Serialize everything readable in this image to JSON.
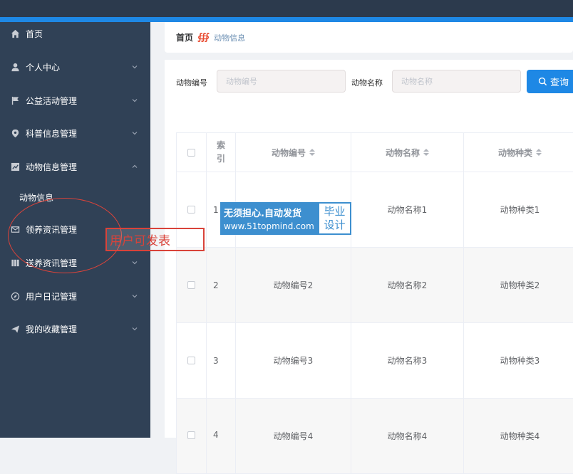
{
  "sidebar": {
    "items": [
      {
        "label": "首页",
        "icon": "home-icon"
      },
      {
        "label": "个人中心",
        "icon": "user-icon"
      },
      {
        "label": "公益活动管理",
        "icon": "flag-icon"
      },
      {
        "label": "科普信息管理",
        "icon": "location-icon"
      },
      {
        "label": "动物信息管理",
        "icon": "chart-icon"
      },
      {
        "label": "领养资讯管理",
        "icon": "mail-icon"
      },
      {
        "label": "送养资讯管理",
        "icon": "bookmark-icon"
      },
      {
        "label": "用户日记管理",
        "icon": "compass-icon"
      },
      {
        "label": "我的收藏管理",
        "icon": "send-icon"
      }
    ],
    "submenu_label": "动物信息"
  },
  "breadcrumb": {
    "home": "首页",
    "separator": "∰",
    "current": "动物信息"
  },
  "search": {
    "field1_label": "动物编号",
    "field1_placeholder": "动物编号",
    "field2_label": "动物名称",
    "field2_placeholder": "动物名称",
    "button_label": "查询"
  },
  "table": {
    "headers": [
      "索\n引",
      "动物编号",
      "动物名称",
      "动物种类"
    ],
    "rows": [
      {
        "index": "1",
        "code": "",
        "name": "动物名称1",
        "type": "动物种类1"
      },
      {
        "index": "2",
        "code": "动物编号2",
        "name": "动物名称2",
        "type": "动物种类2"
      },
      {
        "index": "3",
        "code": "动物编号3",
        "name": "动物名称3",
        "type": "动物种类3"
      },
      {
        "index": "4",
        "code": "动物编号4",
        "name": "动物名称4",
        "type": "动物种类4"
      }
    ]
  },
  "annotation": {
    "note": "用户可发表"
  },
  "watermark": {
    "line1": "无须担心.自动发货",
    "line2": "www.51topmind.com",
    "right_line1": "毕业",
    "right_line2": "设计"
  },
  "colors": {
    "sidebar_bg": "#304156",
    "accent": "#1e88e5",
    "annotation_red": "#d9433a",
    "watermark_blue": "#3d8fcf"
  }
}
